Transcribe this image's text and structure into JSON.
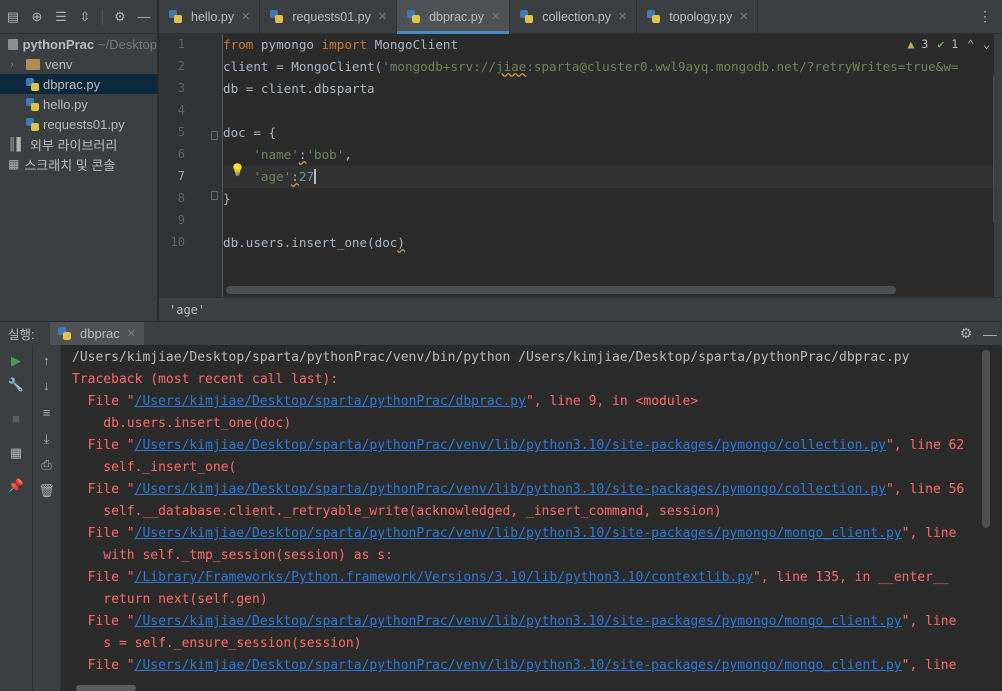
{
  "project": {
    "root_name": "pythonPrac",
    "root_path": "~/Desktop",
    "items": [
      {
        "label": "venv",
        "type": "folder"
      },
      {
        "label": "dbprac.py",
        "type": "py",
        "selected": true
      },
      {
        "label": "hello.py",
        "type": "py"
      },
      {
        "label": "requests01.py",
        "type": "py"
      },
      {
        "label": "외부 라이브러리",
        "type": "library"
      },
      {
        "label": "스크래치 및 콘솔",
        "type": "scratch"
      }
    ]
  },
  "tabs": [
    {
      "label": "hello.py"
    },
    {
      "label": "requests01.py"
    },
    {
      "label": "dbprac.py",
      "active": true
    },
    {
      "label": "collection.py"
    },
    {
      "label": "topology.py"
    }
  ],
  "editor": {
    "line_numbers": [
      "1",
      "2",
      "3",
      "4",
      "5",
      "6",
      "7",
      "8",
      "9",
      "10"
    ],
    "inspection": {
      "warnings": "3",
      "weak_warnings": "1"
    },
    "breadcrumb": "'age'"
  },
  "run": {
    "label": "실행:",
    "tab_label": "dbprac"
  },
  "console": {
    "lines": [
      {
        "kind": "plain",
        "text": "/Users/kimjiae/Desktop/sparta/pythonPrac/venv/bin/python /Users/kimjiae/Desktop/sparta/pythonPrac/dbprac.py"
      },
      {
        "kind": "err",
        "text": "Traceback (most recent call last):"
      },
      {
        "kind": "file",
        "pre": "  File \"",
        "link": "/Users/kimjiae/Desktop/sparta/pythonPrac/dbprac.py",
        "post": "\", line 9, in <module>"
      },
      {
        "kind": "err",
        "text": "    db.users.insert_one(doc)"
      },
      {
        "kind": "file",
        "pre": "  File \"",
        "link": "/Users/kimjiae/Desktop/sparta/pythonPrac/venv/lib/python3.10/site-packages/pymongo/collection.py",
        "post": "\", line 62"
      },
      {
        "kind": "err",
        "text": "    self._insert_one("
      },
      {
        "kind": "file",
        "pre": "  File \"",
        "link": "/Users/kimjiae/Desktop/sparta/pythonPrac/venv/lib/python3.10/site-packages/pymongo/collection.py",
        "post": "\", line 56"
      },
      {
        "kind": "err",
        "text": "    self.__database.client._retryable_write(acknowledged, _insert_command, session)"
      },
      {
        "kind": "file",
        "pre": "  File \"",
        "link": "/Users/kimjiae/Desktop/sparta/pythonPrac/venv/lib/python3.10/site-packages/pymongo/mongo_client.py",
        "post": "\", line"
      },
      {
        "kind": "err",
        "text": "    with self._tmp_session(session) as s:"
      },
      {
        "kind": "file",
        "pre": "  File \"",
        "link": "/Library/Frameworks/Python.framework/Versions/3.10/lib/python3.10/contextlib.py",
        "post": "\", line 135, in __enter__"
      },
      {
        "kind": "err",
        "text": "    return next(self.gen)"
      },
      {
        "kind": "file",
        "pre": "  File \"",
        "link": "/Users/kimjiae/Desktop/sparta/pythonPrac/venv/lib/python3.10/site-packages/pymongo/mongo_client.py",
        "post": "\", line"
      },
      {
        "kind": "err",
        "text": "    s = self._ensure_session(session)"
      },
      {
        "kind": "file",
        "pre": "  File \"",
        "link": "/Users/kimjiae/Desktop/sparta/pythonPrac/venv/lib/python3.10/site-packages/pymongo/mongo_client.py",
        "post": "\", line"
      }
    ]
  },
  "colors": {
    "keyword": "#cc7832",
    "string": "#6a8759",
    "number": "#6897bb",
    "error": "#ff6b68",
    "link": "#287bde",
    "accent": "#4a88c7"
  },
  "icons": {
    "project_toolbar": [
      "sidebar-toggle-icon",
      "crosshair-icon",
      "expand-all-icon",
      "collapse-all-icon",
      "gear-icon",
      "minimize-icon"
    ],
    "tab_overflow": "more-tabs-icon",
    "run_toolbar_left": [
      "run-icon",
      "wrench-icon",
      "stop-icon",
      "layout-icon",
      "pin-icon"
    ],
    "run_toolbar_right": [
      "up-arrow-icon",
      "down-arrow-icon",
      "soft-wrap-icon",
      "scroll-to-end-icon",
      "print-icon",
      "trash-icon"
    ]
  }
}
